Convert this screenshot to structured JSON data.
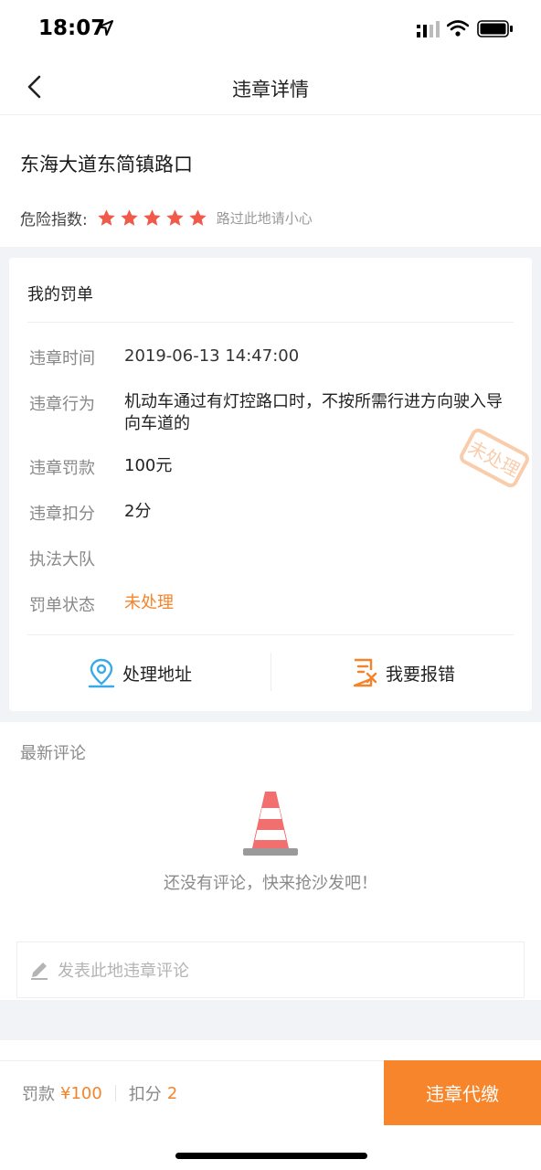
{
  "status_bar": {
    "time": "18:07"
  },
  "nav": {
    "title": "违章详情"
  },
  "location": {
    "name": "东海大道东简镇路口",
    "danger_label": "危险指数:",
    "danger_stars": 5,
    "danger_note": "路过此地请小心"
  },
  "fine_card": {
    "title": "我的罚单",
    "rows": [
      {
        "label": "违章时间",
        "value": "2019-06-13 14:47:00"
      },
      {
        "label": "违章行为",
        "value": "机动车通过有灯控路口时，不按所需行进方向驶入导向车道的"
      },
      {
        "label": "违章罚款",
        "value": "100元"
      },
      {
        "label": "违章扣分",
        "value": "2分"
      },
      {
        "label": "执法大队",
        "value": ""
      },
      {
        "label": "罚单状态",
        "value": "未处理"
      }
    ],
    "stamp_text": "未处理",
    "actions": {
      "address": "处理地址",
      "report_error": "我要报错"
    }
  },
  "comments": {
    "title": "最新评论",
    "empty_text": "还没有评论，快来抢沙发吧！",
    "input_placeholder": "发表此地违章评论"
  },
  "bottom_bar": {
    "fine_label": "罚款",
    "fine_value": "¥100",
    "points_label": "扣分",
    "points_value": "2",
    "pay_button": "违章代缴"
  },
  "colors": {
    "accent": "#f7852b",
    "star": "#f05a4a",
    "map_pin": "#3aa9e8"
  }
}
